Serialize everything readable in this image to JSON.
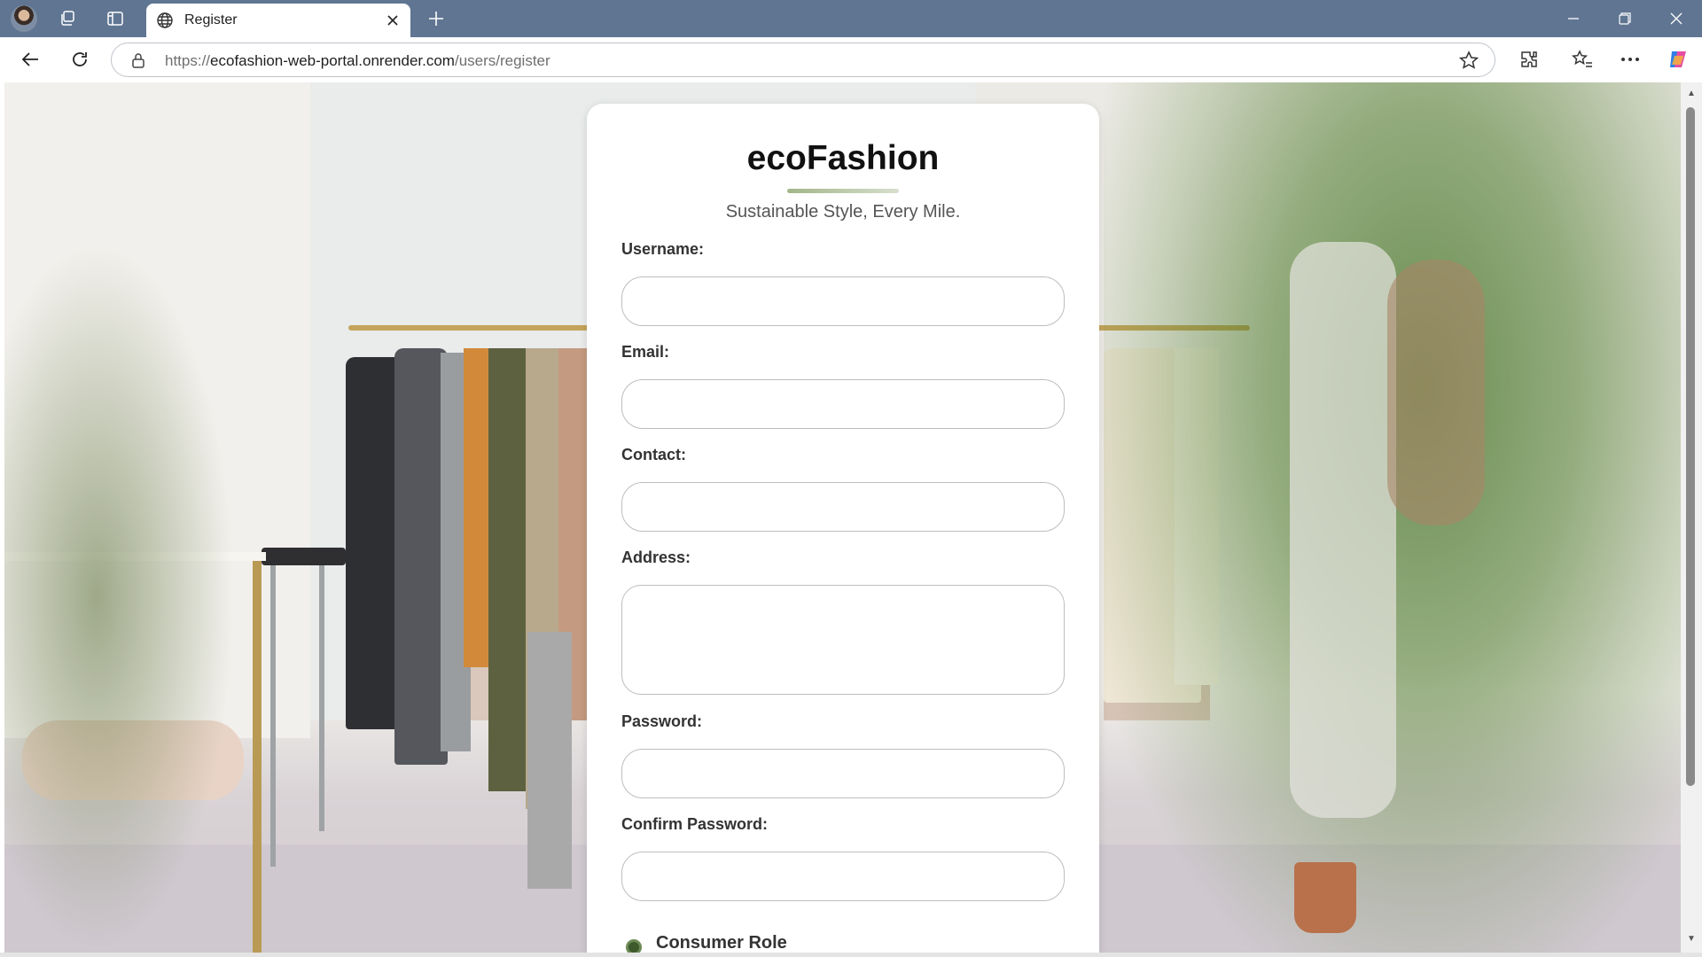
{
  "browser": {
    "tab_title": "Register",
    "url_prefix": "https://",
    "url_host": "ecofashion-web-portal.onrender.com",
    "url_path": "/users/register"
  },
  "page": {
    "brand": "ecoFashion",
    "tagline": "Sustainable Style, Every Mile.",
    "fields": {
      "username_label": "Username:",
      "email_label": "Email:",
      "contact_label": "Contact:",
      "address_label": "Address:",
      "password_label": "Password:",
      "confirm_password_label": "Confirm Password:"
    },
    "role_label": "Consumer Role"
  },
  "colors": {
    "titlebar": "#5f7592",
    "accent_green": "#6b8a55"
  }
}
